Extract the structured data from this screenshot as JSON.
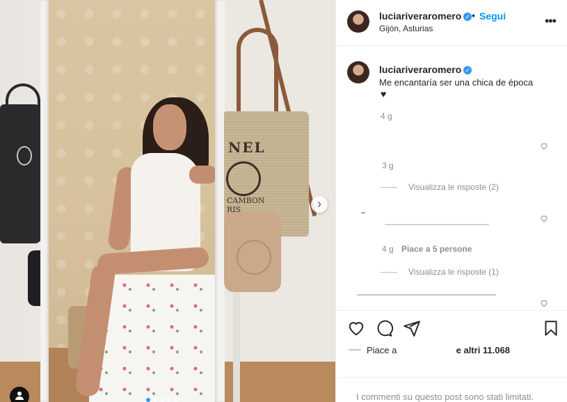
{
  "photo": {
    "tote_print": "NEL",
    "tote_sub": "CAMBON\nRIS"
  },
  "header": {
    "username": "luciariveraromero",
    "separator": "•",
    "follow_label": "Segui",
    "location": "Gijón, Asturias",
    "more_label": "•••"
  },
  "caption": {
    "username": "luciariveraromero",
    "text": "Me encantaría ser una chica de época",
    "emoji": "♥",
    "time": "4 g"
  },
  "comments": [
    {
      "time": "3 g",
      "replies_label": "Visualizza le risposte (2)"
    },
    {
      "time": "4 g",
      "likes": "Piace a 5 persone",
      "replies_label": "Visualizza le risposte (1)"
    }
  ],
  "likes": {
    "prefix": "Piace a",
    "suffix": "e altri 11.068"
  },
  "footer": {
    "limited_text": "I commenti su questo post sono stati limitati."
  },
  "icons": {
    "verified": "verified-icon",
    "carousel_next": "chevron-right-icon",
    "tag": "user-tag-icon"
  },
  "colors": {
    "link_blue": "#0095f6",
    "verified_blue": "#3897f0",
    "muted": "#8e8e8e"
  }
}
